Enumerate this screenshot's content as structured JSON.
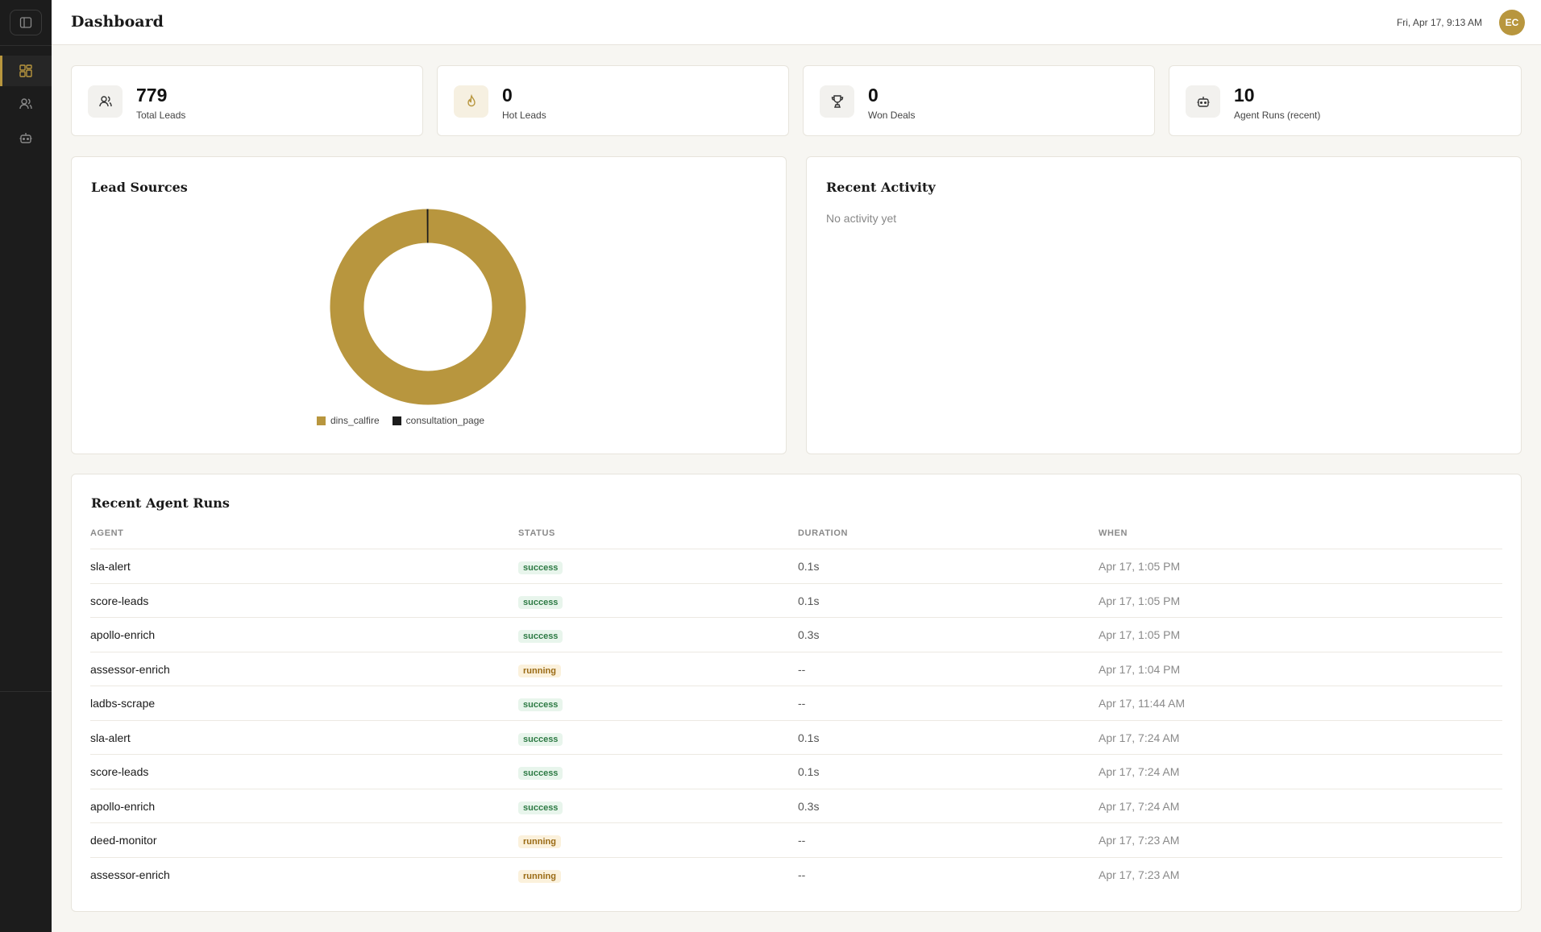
{
  "header": {
    "title": "Dashboard",
    "datetime": "Fri, Apr 17, 9:13 AM",
    "avatar_initials": "EC"
  },
  "sidebar": {
    "items": [
      {
        "icon": "dashboard-icon",
        "active": true
      },
      {
        "icon": "users-icon",
        "active": false
      },
      {
        "icon": "bot-icon",
        "active": false
      }
    ]
  },
  "stats": [
    {
      "value": "779",
      "label": "Total Leads",
      "icon": "users-icon"
    },
    {
      "value": "0",
      "label": "Hot Leads",
      "icon": "flame-icon"
    },
    {
      "value": "0",
      "label": "Won Deals",
      "icon": "trophy-icon"
    },
    {
      "value": "10",
      "label": "Agent Runs (recent)",
      "icon": "bot-icon"
    }
  ],
  "lead_sources": {
    "title": "Lead Sources",
    "colors": {
      "dins_calfire": "#b8963e",
      "consultation_page": "#1c1c1c"
    }
  },
  "chart_data": {
    "type": "pie",
    "categories": [
      "dins_calfire",
      "consultation_page"
    ],
    "values": [
      778,
      1
    ]
  },
  "recent_activity": {
    "title": "Recent Activity",
    "empty_text": "No activity yet"
  },
  "agent_runs": {
    "title": "Recent Agent Runs",
    "columns": [
      "AGENT",
      "STATUS",
      "DURATION",
      "WHEN"
    ],
    "rows": [
      {
        "agent": "sla-alert",
        "status": "success",
        "duration": "0.1s",
        "when": "Apr 17, 1:05 PM"
      },
      {
        "agent": "score-leads",
        "status": "success",
        "duration": "0.1s",
        "when": "Apr 17, 1:05 PM"
      },
      {
        "agent": "apollo-enrich",
        "status": "success",
        "duration": "0.3s",
        "when": "Apr 17, 1:05 PM"
      },
      {
        "agent": "assessor-enrich",
        "status": "running",
        "duration": "--",
        "when": "Apr 17, 1:04 PM"
      },
      {
        "agent": "ladbs-scrape",
        "status": "success",
        "duration": "--",
        "when": "Apr 17, 11:44 AM"
      },
      {
        "agent": "sla-alert",
        "status": "success",
        "duration": "0.1s",
        "when": "Apr 17, 7:24 AM"
      },
      {
        "agent": "score-leads",
        "status": "success",
        "duration": "0.1s",
        "when": "Apr 17, 7:24 AM"
      },
      {
        "agent": "apollo-enrich",
        "status": "success",
        "duration": "0.3s",
        "when": "Apr 17, 7:24 AM"
      },
      {
        "agent": "deed-monitor",
        "status": "running",
        "duration": "--",
        "when": "Apr 17, 7:23 AM"
      },
      {
        "agent": "assessor-enrich",
        "status": "running",
        "duration": "--",
        "when": "Apr 17, 7:23 AM"
      }
    ]
  }
}
